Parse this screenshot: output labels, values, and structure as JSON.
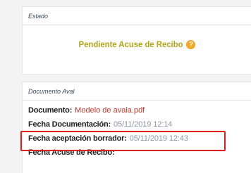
{
  "estado": {
    "title": "Estado",
    "status_text": "Pendiente Acuse de Recibo",
    "help_icon_glyph": "?",
    "help_icon": "question-circle-icon",
    "status_color": "#b4a51a",
    "help_color": "#f5a623"
  },
  "documento_aval": {
    "title": "Documento Aval",
    "fields": [
      {
        "label": "Documento:",
        "value": "Modelo de avala.pdf"
      },
      {
        "label": "Fecha Documentación:",
        "value": "05/11/2019 12:14"
      },
      {
        "label": "Fecha aceptación borrador:",
        "value": "05/11/2019 12:43"
      },
      {
        "label": "Fecha Acuse de Recibo:",
        "value": ""
      }
    ]
  },
  "highlight_color": "#e02020"
}
